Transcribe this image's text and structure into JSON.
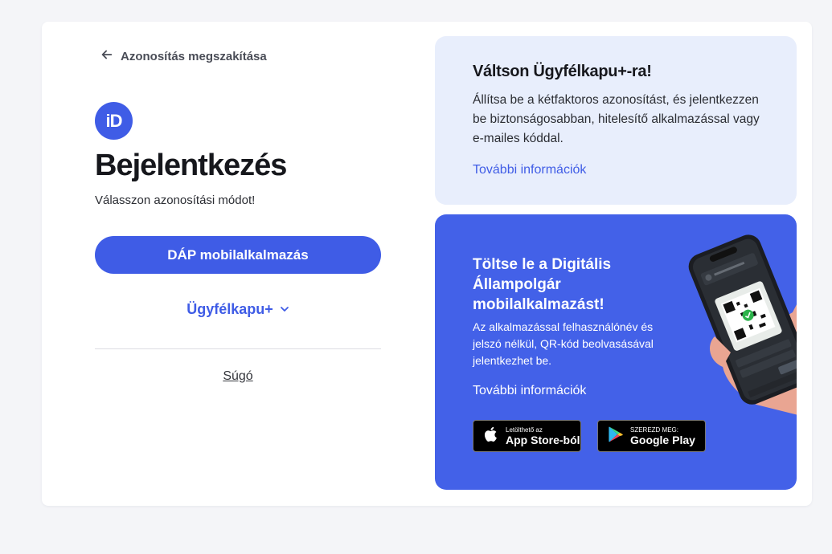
{
  "nav": {
    "back_label": "Azonosítás megszakítása"
  },
  "logo": {
    "text": "iD"
  },
  "login": {
    "title": "Bejelentkezés",
    "subtitle": "Válasszon azonosítási módot!",
    "primary_button": "DÁP mobilalkalmazás",
    "alt_method": "Ügyfélkapu+",
    "help": "Súgó"
  },
  "info_panel": {
    "title": "Váltson Ügyfélkapu+-ra!",
    "body": "Állítsa be a kétfaktoros azonosítást, és jelentkezzen be biztonságosabban, hitelesítő alkalmazással vagy e-mailes kóddal.",
    "link": "További információk"
  },
  "promo_panel": {
    "title": "Töltse le a Digitális Állampolgár mobilalkalmazást!",
    "body": "Az alkalmazással felhasználónév és jelszó nélkül, QR-kód beolvasásával jelentkezhet be.",
    "link": "További információk",
    "app_store": {
      "small": "Letölthető az",
      "big": "App Store-ból"
    },
    "google_play": {
      "small": "SZEREZD MEG:",
      "big": "Google Play"
    }
  },
  "colors": {
    "accent": "#3f5ce6",
    "promo_bg": "#4361e8",
    "info_bg": "#e8eefc",
    "page_bg": "#f4f5f8"
  },
  "icons": [
    "arrow-left-icon",
    "chevron-down-icon",
    "apple-icon",
    "google-play-icon"
  ]
}
